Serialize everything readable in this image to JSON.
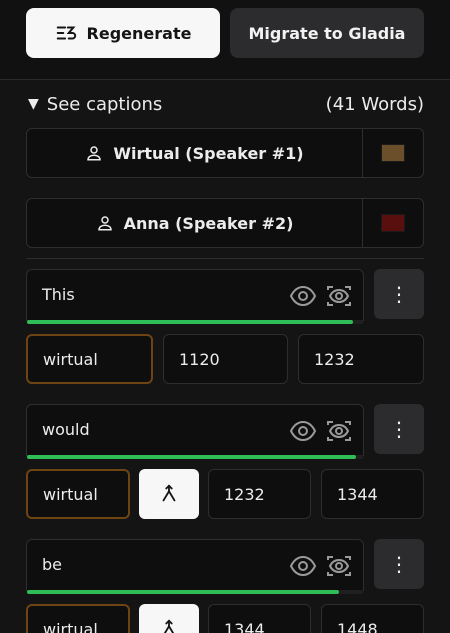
{
  "toolbar": {
    "regenerate_label": "Regenerate",
    "migrate_label": "Migrate to Gladia"
  },
  "captions": {
    "toggle_label": "See captions",
    "word_count": "(41 Words)"
  },
  "speakers": [
    {
      "label": "Wirtual (Speaker #1)",
      "color": "#6b4f2a"
    },
    {
      "label": "Anna (Speaker #2)",
      "color": "#5a0f0f"
    }
  ],
  "words": [
    {
      "text": "This",
      "speaker": "wirtual",
      "start": "1120",
      "end": "1232",
      "progress": 0.97
    },
    {
      "text": "would",
      "speaker": "wirtual",
      "start": "1232",
      "end": "1344",
      "progress": 0.98
    },
    {
      "text": "be",
      "speaker": "wirtual",
      "start": "1344",
      "end": "1448",
      "progress": 0.93
    }
  ],
  "colors": {
    "accent_green": "#2ebd57",
    "speaker_border": "#6e4413"
  },
  "icons": {
    "regenerate": "regenerate-icon",
    "speaker": "person-icon",
    "visibility": "eye-icon",
    "preview": "camera-view-icon",
    "menu": "kebab-menu-icon",
    "merge": "merge-icon"
  }
}
